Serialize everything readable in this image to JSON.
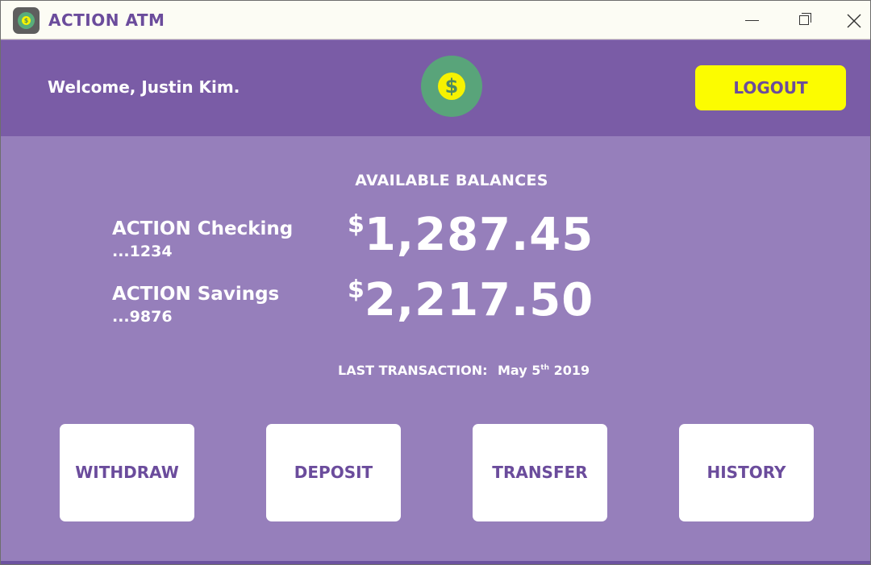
{
  "window": {
    "title": "ACTION ATM",
    "controls": {
      "minimize": "minimize",
      "maximize": "maximize",
      "close": "close"
    }
  },
  "header": {
    "welcome": "Welcome, Justin Kim.",
    "logo_symbol": "$",
    "logout_label": "LOGOUT"
  },
  "balances": {
    "title": "AVAILABLE BALANCES",
    "currency_symbol": "$",
    "accounts": [
      {
        "name": "ACTION Checking",
        "number": "...1234",
        "amount": "1,287.45"
      },
      {
        "name": "ACTION Savings",
        "number": "...9876",
        "amount": "2,217.50"
      }
    ],
    "last_transaction": {
      "label": "LAST TRANSACTION:",
      "date_day": "May 5",
      "date_suffix": "th",
      "date_year": "2019"
    }
  },
  "actions": {
    "withdraw": "WITHDRAW",
    "deposit": "DEPOSIT",
    "transfer": "TRANSFER",
    "history": "HISTORY"
  },
  "colors": {
    "title_bar": "#fcfcf4",
    "header_band": "#7a5ca6",
    "body": "#967fbb",
    "accent_yellow": "#fcfc00",
    "coin_green": "#59a47a",
    "brand_purple": "#6b4c9c"
  },
  "icons": {
    "app_icon": "dollar-coin-icon",
    "logo": "dollar-coin-icon",
    "minimize": "minimize-icon",
    "maximize": "restore-icon",
    "close": "close-icon"
  }
}
